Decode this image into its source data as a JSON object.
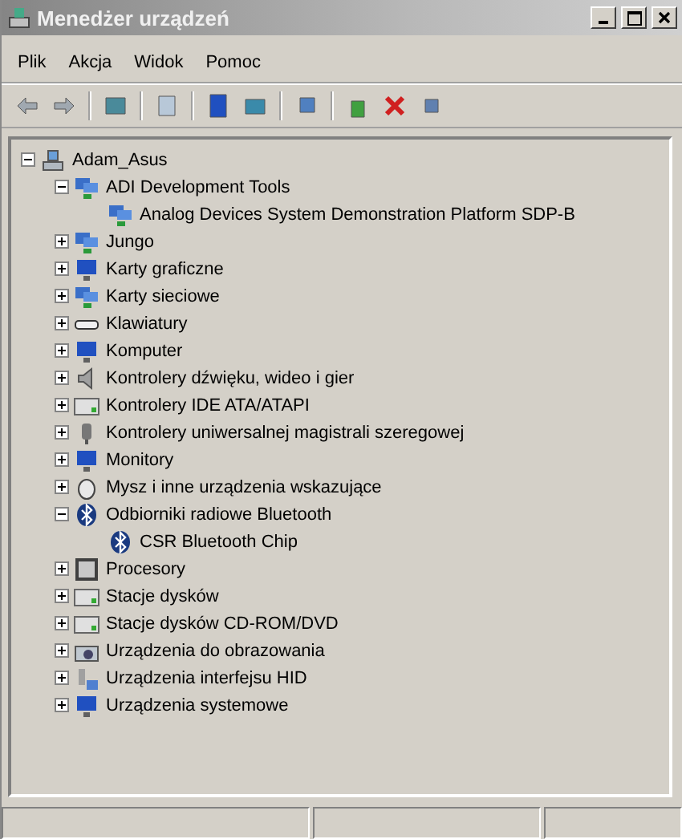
{
  "window": {
    "title": "Menedżer urządzeń"
  },
  "menu": [
    {
      "label": "Plik"
    },
    {
      "label": "Akcja"
    },
    {
      "label": "Widok"
    },
    {
      "label": "Pomoc"
    }
  ],
  "tree": {
    "label": "Adam_Asus",
    "kind": "computer",
    "expanded": true,
    "children": [
      {
        "label": "ADI Development Tools",
        "kind": "network",
        "expanded": true,
        "children": [
          {
            "label": "Analog Devices System Demonstration Platform SDP-B",
            "kind": "network"
          }
        ]
      },
      {
        "label": "Jungo",
        "kind": "network",
        "expanded": false
      },
      {
        "label": "Karty graficzne",
        "kind": "display",
        "expanded": false
      },
      {
        "label": "Karty sieciowe",
        "kind": "network",
        "expanded": false
      },
      {
        "label": "Klawiatury",
        "kind": "keyboard",
        "expanded": false
      },
      {
        "label": "Komputer",
        "kind": "display",
        "expanded": false
      },
      {
        "label": "Kontrolery dźwięku, wideo i gier",
        "kind": "sound",
        "expanded": false
      },
      {
        "label": "Kontrolery IDE ATA/ATAPI",
        "kind": "disk",
        "expanded": false
      },
      {
        "label": "Kontrolery uniwersalnej magistrali szeregowej",
        "kind": "usb",
        "expanded": false
      },
      {
        "label": "Monitory",
        "kind": "display",
        "expanded": false
      },
      {
        "label": "Mysz i inne urządzenia wskazujące",
        "kind": "mouse",
        "expanded": false
      },
      {
        "label": "Odbiorniki radiowe Bluetooth",
        "kind": "bluetooth",
        "expanded": true,
        "children": [
          {
            "label": "CSR Bluetooth Chip",
            "kind": "bluetooth"
          }
        ]
      },
      {
        "label": "Procesory",
        "kind": "cpu",
        "expanded": false
      },
      {
        "label": "Stacje dysków",
        "kind": "disk",
        "expanded": false
      },
      {
        "label": "Stacje dysków CD-ROM/DVD",
        "kind": "disk",
        "expanded": false
      },
      {
        "label": "Urządzenia do obrazowania",
        "kind": "camera",
        "expanded": false
      },
      {
        "label": "Urządzenia interfejsu HID",
        "kind": "hid",
        "expanded": false
      },
      {
        "label": "Urządzenia systemowe",
        "kind": "display",
        "expanded": false
      }
    ]
  }
}
